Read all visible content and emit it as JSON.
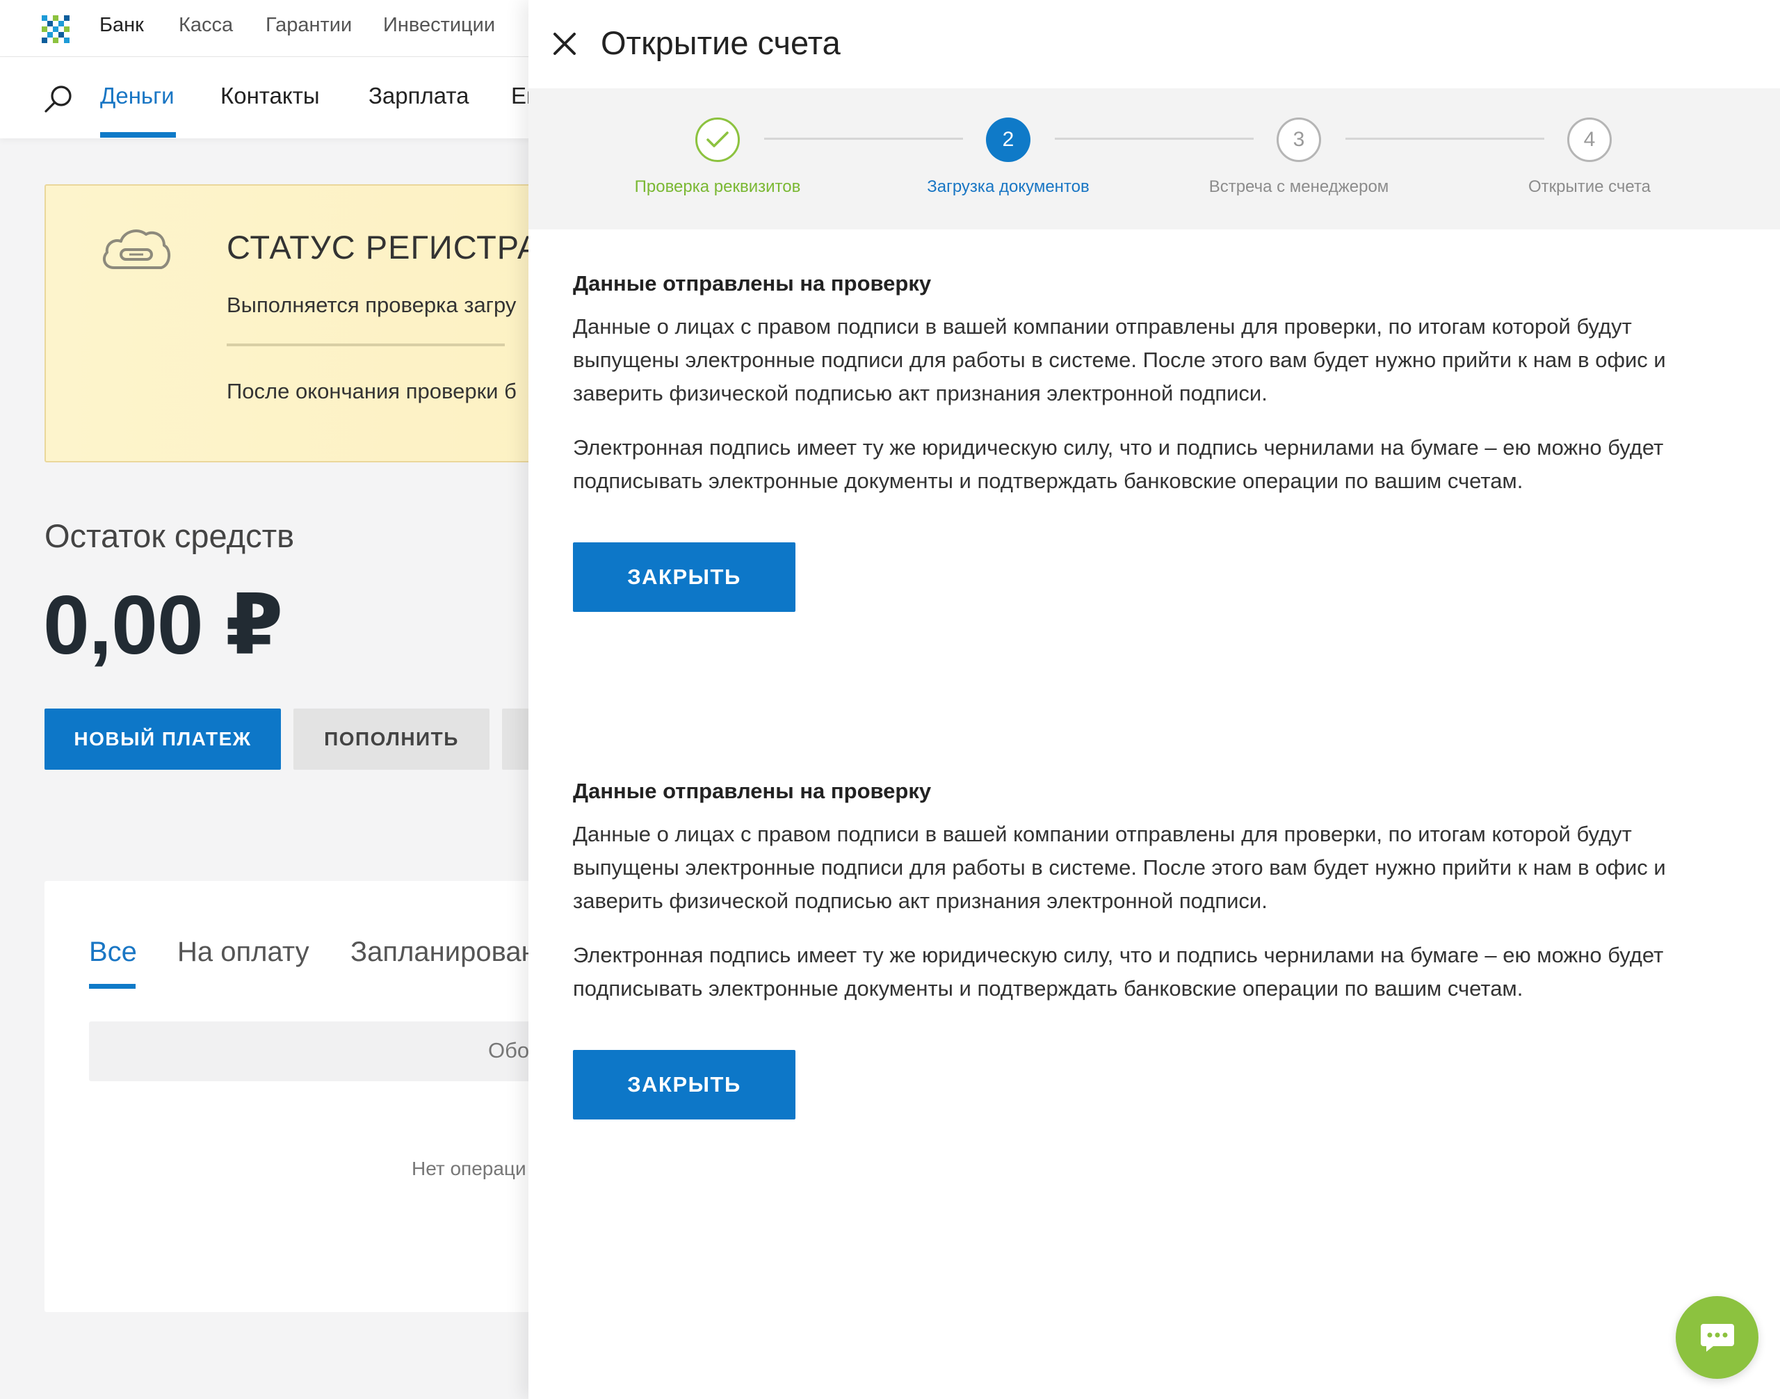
{
  "top_nav": {
    "items": [
      "Банк",
      "Касса",
      "Гарантии",
      "Инвестиции"
    ]
  },
  "sub_nav": {
    "items": [
      "Деньги",
      "Контакты",
      "Зарплата",
      "Ев"
    ]
  },
  "status_card": {
    "title": "СТАТУС РЕГИСТРАЦ",
    "text": "Выполняется проверка загру",
    "note": "После окончания проверки б"
  },
  "balance": {
    "label": "Остаток средств",
    "value": "0,00 ₽"
  },
  "actions": {
    "new_payment": "НОВЫЙ ПЛАТЕЖ",
    "top_up": "ПОПОЛНИТЬ"
  },
  "operations": {
    "tabs": [
      "Все",
      "На оплату",
      "Запланирован"
    ],
    "filter_text": "Обо",
    "empty_text": "Нет операци"
  },
  "panel": {
    "title": "Открытие счета",
    "steps": [
      {
        "number": "",
        "label": "Проверка реквизитов",
        "state": "done"
      },
      {
        "number": "2",
        "label": "Загрузка документов",
        "state": "current"
      },
      {
        "number": "3",
        "label": "Встреча с менеджером",
        "state": "todo"
      },
      {
        "number": "4",
        "label": "Открытие счета",
        "state": "todo"
      }
    ],
    "blocks": [
      {
        "title": "Данные отправлены на проверку",
        "paragraph_1": "Данные о лицах с правом подписи в вашей компании отправлены для проверки, по итогам которой будут выпущены электронные подписи для работы в системе. После этого вам будет нужно прийти к нам в офис и заверить физической подписью акт признания электронной подписи.",
        "paragraph_2": "Электронная подпись имеет ту же юридическую силу, что и подпись чернилами на бумаге – ею можно будет подписывать электронные документы и подтверждать банковские операции по вашим счетам.",
        "close_label": "ЗАКРЫТЬ"
      },
      {
        "title": "Данные отправлены на проверку",
        "paragraph_1": "Данные о лицах с правом подписи в вашей компании отправлены для проверки, по итогам которой будут выпущены электронные подписи для работы в системе. После этого вам будет нужно прийти к нам в офис и заверить физической подписью акт признания электронной подписи.",
        "paragraph_2": "Электронная подпись имеет ту же юридическую силу, что и подпись чернилами на бумаге – ею можно будет подписывать электронные документы и подтверждать банковские операции по вашим счетам.",
        "close_label": "ЗАКРЫТЬ"
      }
    ]
  },
  "icons": {
    "logo": "bank-logo-icon",
    "search": "search-icon",
    "cloud": "cloud-icon",
    "close": "close-icon",
    "check": "check-icon",
    "chat": "chat-icon"
  },
  "colors": {
    "accent": "#0d77c8",
    "success": "#8cc23f",
    "status_bg": "#fdf0c0"
  }
}
